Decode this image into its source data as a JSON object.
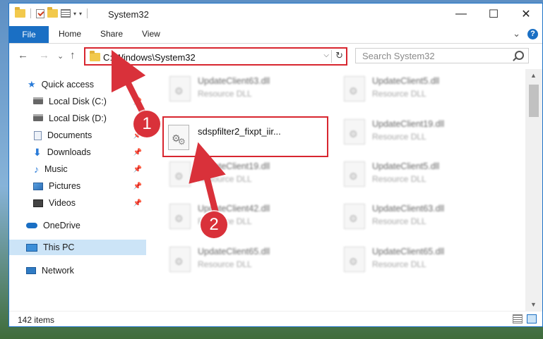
{
  "window": {
    "title": "System32",
    "controls": {
      "minimize": "—",
      "maximize": "☐",
      "close": "✕"
    }
  },
  "ribbon": {
    "tabs": [
      "File",
      "Home",
      "Share",
      "View"
    ],
    "expand_glyph": "⌄",
    "help_glyph": "?"
  },
  "nav": {
    "back": "←",
    "forward": "→",
    "recent": "⌄",
    "up": "↑",
    "address": "C:\\Windows\\System32",
    "address_dropdown": "⌵",
    "refresh": "↻",
    "search_placeholder": "Search System32"
  },
  "sidebar": {
    "items": [
      {
        "label": "Quick access",
        "icon": "star-icon",
        "pinned": false
      },
      {
        "label": "Local Disk (C:)",
        "icon": "drive-icon",
        "pinned": true
      },
      {
        "label": "Local Disk (D:)",
        "icon": "drive-icon",
        "pinned": false
      },
      {
        "label": "Documents",
        "icon": "documents-icon",
        "pinned": true
      },
      {
        "label": "Downloads",
        "icon": "downloads-icon",
        "pinned": true
      },
      {
        "label": "Music",
        "icon": "music-icon",
        "pinned": true
      },
      {
        "label": "Pictures",
        "icon": "pictures-icon",
        "pinned": true
      },
      {
        "label": "Videos",
        "icon": "videos-icon",
        "pinned": true
      },
      {
        "label": "OneDrive",
        "icon": "onedrive-icon",
        "pinned": false
      },
      {
        "label": "This PC",
        "icon": "this-pc-icon",
        "pinned": false,
        "selected": true
      },
      {
        "label": "Network",
        "icon": "network-icon",
        "pinned": false
      }
    ],
    "pin_glyph": "📌"
  },
  "files": {
    "left_column": [
      {
        "name": "UpdateClient63.dll",
        "type": "Resource DLL"
      },
      {
        "name": "UpdateClient19.dll",
        "type": "Resource DLL"
      },
      {
        "name": "UpdateClient42.dll",
        "type": "Resource DLL"
      },
      {
        "name": "UpdateClient65.dll",
        "type": "Resource DLL"
      }
    ],
    "right_column": [
      {
        "name": "UpdateClient5.dll",
        "type": "Resource DLL"
      },
      {
        "name": "UpdateClient19.dll",
        "type": "Resource DLL"
      },
      {
        "name": "UpdateClient5.dll",
        "type": "Resource DLL"
      },
      {
        "name": "UpdateClient63.dll",
        "type": "Resource DLL"
      },
      {
        "name": "UpdateClient65.dll",
        "type": "Resource DLL"
      }
    ],
    "highlighted": {
      "name": "sdspfilter2_fixpt_iir..."
    }
  },
  "status": {
    "item_count": "142 items"
  },
  "annotations": {
    "step1": "1",
    "step2": "2",
    "highlight_color": "#d8262f"
  }
}
